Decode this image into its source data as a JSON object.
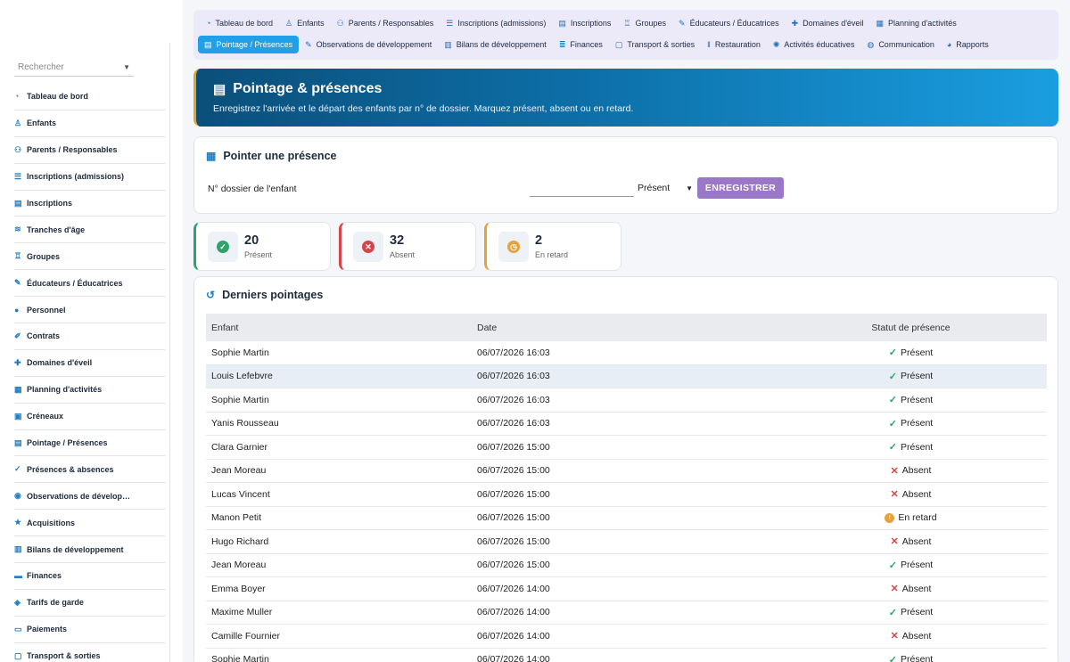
{
  "sidebar": {
    "search_placeholder": "Rechercher",
    "items": [
      {
        "icon": "gauge-icon",
        "glyph": "◔",
        "label": "Tableau de bord"
      },
      {
        "icon": "child-icon",
        "glyph": "♙",
        "label": "Enfants"
      },
      {
        "icon": "users-icon",
        "glyph": "⚇",
        "label": "Parents / Responsables"
      },
      {
        "icon": "list-icon",
        "glyph": "☰",
        "label": "Inscriptions (admissions)"
      },
      {
        "icon": "clipboard-icon",
        "glyph": "▤",
        "label": "Inscriptions"
      },
      {
        "icon": "layers-icon",
        "glyph": "≋",
        "label": "Tranches d'âge"
      },
      {
        "icon": "group-icon",
        "glyph": "♖",
        "label": "Groupes"
      },
      {
        "icon": "educator-icon",
        "glyph": "✎",
        "label": "Éducateurs / Éducatrices"
      },
      {
        "icon": "person-icon",
        "glyph": "●",
        "label": "Personnel"
      },
      {
        "icon": "contract-icon",
        "glyph": "✐",
        "label": "Contrats"
      },
      {
        "icon": "puzzle-icon",
        "glyph": "✚",
        "label": "Domaines d'éveil"
      },
      {
        "icon": "calendar-icon",
        "glyph": "▦",
        "label": "Planning d'activités"
      },
      {
        "icon": "calendar-slot-icon",
        "glyph": "▣",
        "label": "Créneaux"
      },
      {
        "icon": "clipboard-check-icon",
        "glyph": "▤",
        "label": "Pointage / Présences"
      },
      {
        "icon": "user-check-icon",
        "glyph": "✓",
        "label": "Présences & absences"
      },
      {
        "icon": "observation-icon",
        "glyph": "◉",
        "label": "Observations de dévelop…"
      },
      {
        "icon": "star-icon",
        "glyph": "★",
        "label": "Acquisitions"
      },
      {
        "icon": "report-icon",
        "glyph": "▥",
        "label": "Bilans de développement"
      },
      {
        "icon": "finance-icon",
        "glyph": "▬",
        "label": "Finances"
      },
      {
        "icon": "tag-icon",
        "glyph": "◈",
        "label": "Tarifs de garde"
      },
      {
        "icon": "payment-icon",
        "glyph": "▭",
        "label": "Paiements"
      },
      {
        "icon": "bus-icon",
        "glyph": "▢",
        "label": "Transport & sorties"
      }
    ]
  },
  "topnav": {
    "row1": [
      {
        "icon": "gauge-icon",
        "glyph": "◔",
        "label": "Tableau de bord",
        "active": false
      },
      {
        "icon": "child-icon",
        "glyph": "♙",
        "label": "Enfants",
        "active": false
      },
      {
        "icon": "users-icon",
        "glyph": "⚇",
        "label": "Parents / Responsables",
        "active": false
      },
      {
        "icon": "list-icon",
        "glyph": "☰",
        "label": "Inscriptions (admissions)",
        "active": false
      },
      {
        "icon": "clipboard-icon",
        "glyph": "▤",
        "label": "Inscriptions",
        "active": false
      },
      {
        "icon": "group-icon",
        "glyph": "♖",
        "label": "Groupes",
        "active": false
      },
      {
        "icon": "educator-icon",
        "glyph": "✎",
        "label": "Éducateurs / Éducatrices",
        "active": false
      },
      {
        "icon": "puzzle-icon",
        "glyph": "✚",
        "label": "Domaines d'éveil",
        "active": false
      },
      {
        "icon": "calendar-icon",
        "glyph": "▦",
        "label": "Planning d'activités",
        "active": false
      }
    ],
    "row2": [
      {
        "icon": "clipboard-check-icon",
        "glyph": "▤",
        "label": "Pointage / Présences",
        "active": true
      },
      {
        "icon": "pencil-icon",
        "glyph": "✎",
        "label": "Observations de développement",
        "active": false
      },
      {
        "icon": "document-icon",
        "glyph": "▥",
        "label": "Bilans de développement",
        "active": false
      },
      {
        "icon": "finance-icon",
        "glyph": "≣",
        "label": "Finances",
        "active": false
      },
      {
        "icon": "bus-icon",
        "glyph": "▢",
        "label": "Transport & sorties",
        "active": false
      },
      {
        "icon": "utensils-icon",
        "glyph": "ǁ",
        "label": "Restauration",
        "active": false
      },
      {
        "icon": "activity-icon",
        "glyph": "✺",
        "label": "Activités éducatives",
        "active": false
      },
      {
        "icon": "chat-icon",
        "glyph": "◍",
        "label": "Communication",
        "active": false
      },
      {
        "icon": "pie-chart-icon",
        "glyph": "◕",
        "label": "Rapports",
        "active": false
      }
    ]
  },
  "banner": {
    "title": "Pointage & présences",
    "subtitle": "Enregistrez l'arrivée et le départ des enfants par n° de dossier. Marquez présent, absent ou en retard."
  },
  "pointer": {
    "title": "Pointer une présence",
    "field_label": "N° dossier de l'enfant",
    "field_value": "",
    "status_selected": "Présent",
    "submit_label": "ENREGISTRER"
  },
  "stats": [
    {
      "value": "20",
      "label": "Présent",
      "color": "#2ea36a",
      "icon": "check-circle-icon",
      "glyph": "✓"
    },
    {
      "value": "32",
      "label": "Absent",
      "color": "#d64545",
      "icon": "x-circle-icon",
      "glyph": "✕"
    },
    {
      "value": "2",
      "label": "En retard",
      "color": "#e6a23c",
      "icon": "clock-icon",
      "glyph": "◷"
    }
  ],
  "recent": {
    "title": "Derniers pointages",
    "columns": [
      "Enfant",
      "Date",
      "Statut de présence"
    ],
    "rows": [
      {
        "child": "Sophie Martin",
        "date": "06/07/2026 16:03",
        "status": "Présent",
        "kind": "present"
      },
      {
        "child": "Louis Lefebvre",
        "date": "06/07/2026 16:03",
        "status": "Présent",
        "kind": "present"
      },
      {
        "child": "Sophie Martin",
        "date": "06/07/2026 16:03",
        "status": "Présent",
        "kind": "present"
      },
      {
        "child": "Yanis Rousseau",
        "date": "06/07/2026 16:03",
        "status": "Présent",
        "kind": "present"
      },
      {
        "child": "Clara Garnier",
        "date": "06/07/2026 15:00",
        "status": "Présent",
        "kind": "present"
      },
      {
        "child": "Jean Moreau",
        "date": "06/07/2026 15:00",
        "status": "Absent",
        "kind": "absent"
      },
      {
        "child": "Lucas Vincent",
        "date": "06/07/2026 15:00",
        "status": "Absent",
        "kind": "absent"
      },
      {
        "child": "Manon Petit",
        "date": "06/07/2026 15:00",
        "status": "En retard",
        "kind": "late"
      },
      {
        "child": "Hugo Richard",
        "date": "06/07/2026 15:00",
        "status": "Absent",
        "kind": "absent"
      },
      {
        "child": "Jean Moreau",
        "date": "06/07/2026 15:00",
        "status": "Présent",
        "kind": "present"
      },
      {
        "child": "Emma Boyer",
        "date": "06/07/2026 14:00",
        "status": "Absent",
        "kind": "absent"
      },
      {
        "child": "Maxime Muller",
        "date": "06/07/2026 14:00",
        "status": "Présent",
        "kind": "present"
      },
      {
        "child": "Camille Fournier",
        "date": "06/07/2026 14:00",
        "status": "Absent",
        "kind": "absent"
      },
      {
        "child": "Sophie Martin",
        "date": "06/07/2026 14:00",
        "status": "Présent",
        "kind": "present"
      }
    ]
  }
}
